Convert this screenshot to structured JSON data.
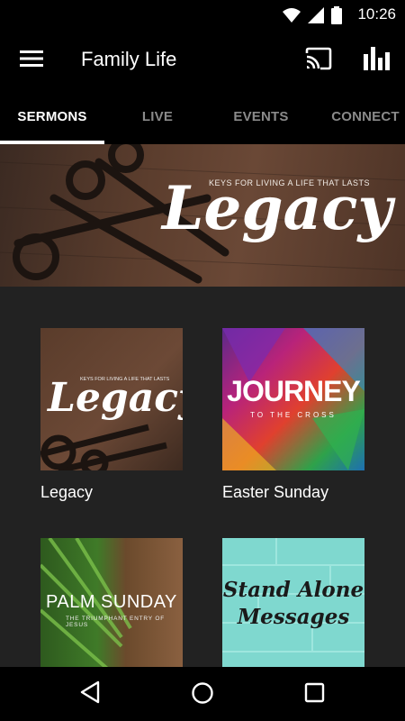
{
  "status_bar": {
    "time": "10:26"
  },
  "app_bar": {
    "title": "Family Life"
  },
  "tabs": [
    {
      "label": "SERMONS",
      "active": true
    },
    {
      "label": "LIVE",
      "active": false
    },
    {
      "label": "EVENTS",
      "active": false
    },
    {
      "label": "CONNECT",
      "active": false
    }
  ],
  "hero": {
    "tagline": "KEYS FOR LIVING A LIFE THAT LASTS",
    "title": "Legacy"
  },
  "series": [
    {
      "label": "Legacy",
      "art_title": "Legacy",
      "art_tagline": "KEYS FOR LIVING A LIFE THAT LASTS"
    },
    {
      "label": "Easter Sunday",
      "art_title": "JOURNEY",
      "art_subtitle": "TO THE CROSS"
    },
    {
      "label": "",
      "art_title": "PALM SUNDAY",
      "art_subtitle": "THE TRIUMPHANT ENTRY OF JESUS"
    },
    {
      "label": "",
      "art_title_line1": "Stand Alone",
      "art_title_line2": "Messages"
    }
  ],
  "colors": {
    "accent": "#ffffff",
    "background": "#222222",
    "bar": "#000000",
    "inactive_tab": "#8a8a8a"
  }
}
